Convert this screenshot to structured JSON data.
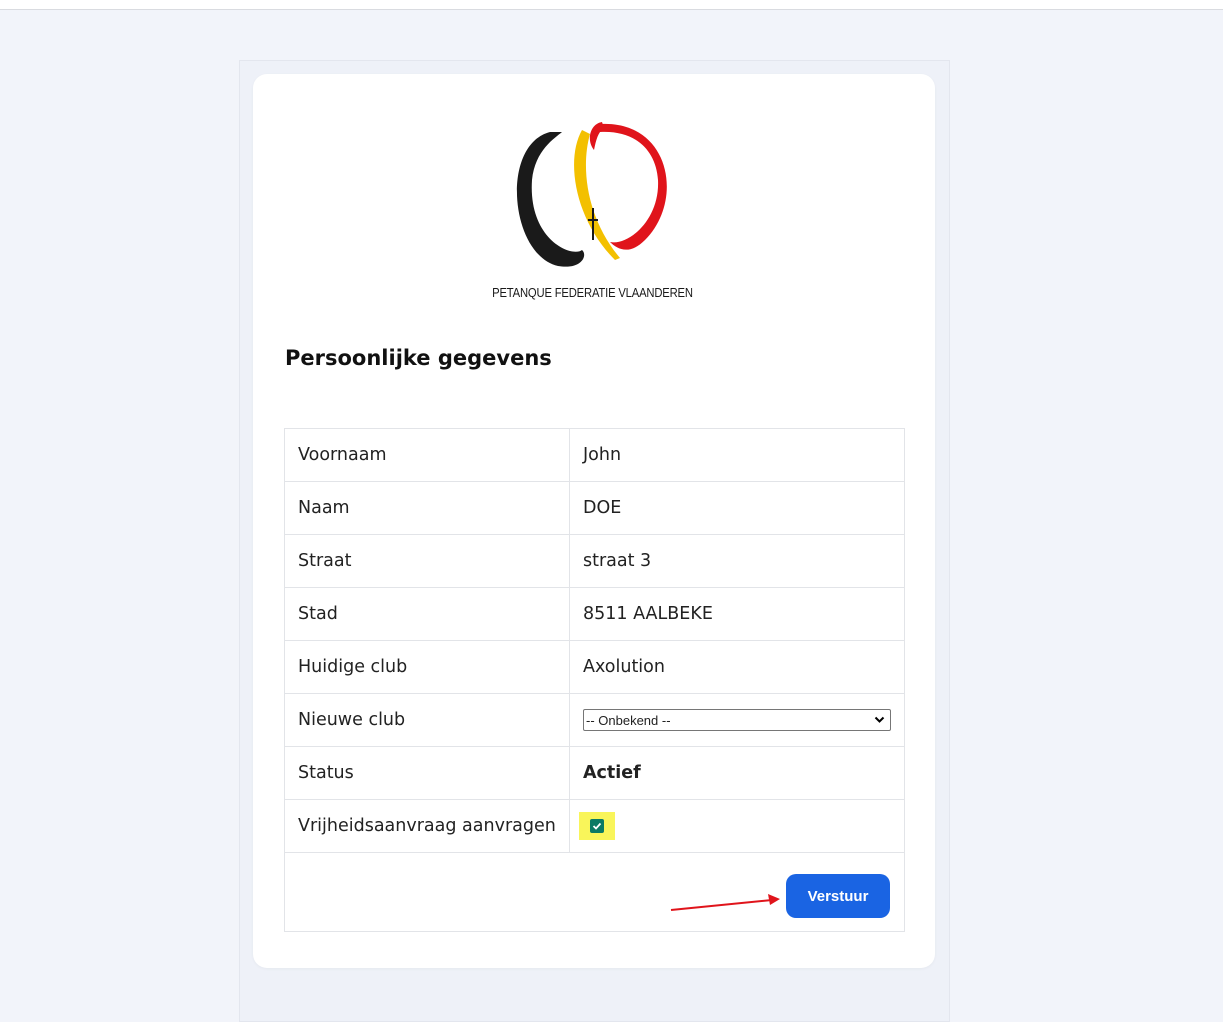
{
  "logo": {
    "caption": "PETANQUE FEDERATIE VLAANDEREN",
    "colors": [
      "#1a1a1a",
      "#f3c000",
      "#e0141b"
    ]
  },
  "page_title": "Persoonlijke gegevens",
  "form": {
    "rows": [
      {
        "label": "Voornaam",
        "value": "John"
      },
      {
        "label": "Naam",
        "value": "DOE"
      },
      {
        "label": "Straat",
        "value": "straat 3"
      },
      {
        "label": "Stad",
        "value": "8511 AALBEKE"
      },
      {
        "label": "Huidige club",
        "value": "Axolution"
      }
    ],
    "new_club_label": "Nieuwe club",
    "new_club_selected": "-- Onbekend --",
    "status_label": "Status",
    "status_value": "Actief",
    "freedom_label": "Vrijheidsaanvraag aanvragen",
    "freedom_checked": true,
    "submit_label": "Verstuur"
  },
  "colors": {
    "accent": "#1a64e3",
    "highlight": "#f9f55a",
    "checkbox": "#0b7a64",
    "annotation": "#e0141b"
  }
}
